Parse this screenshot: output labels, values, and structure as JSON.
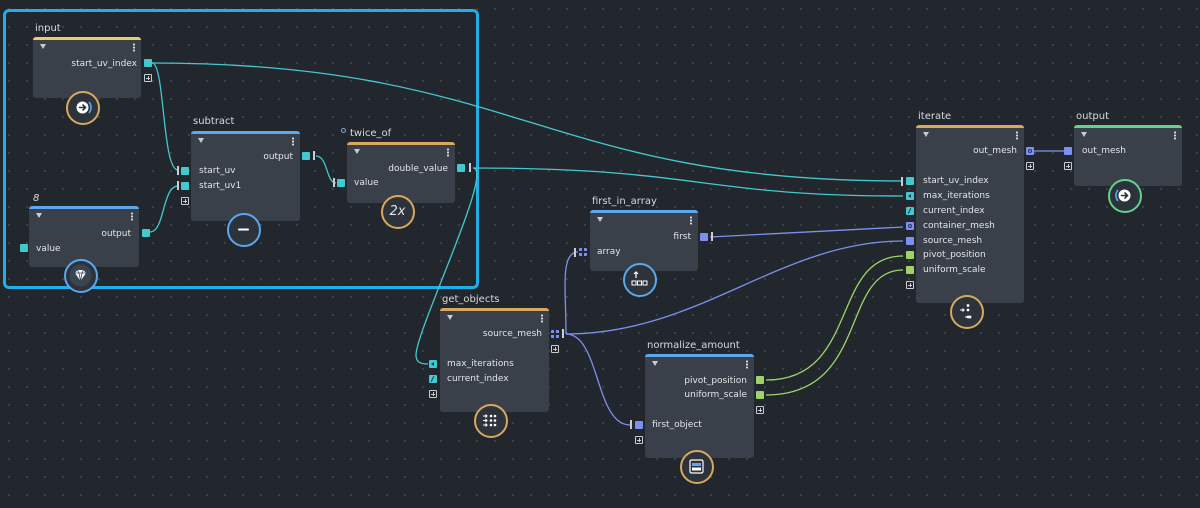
{
  "colors": {
    "background": "#22272d",
    "selection": "#1faee6",
    "node_body": "#3a4049",
    "port_cyan": "#44c8cf",
    "port_green": "#9ed36a",
    "port_blue": "#7d8ff0",
    "header_yellow": "#e8cf6a",
    "header_blue": "#5aa8f0",
    "header_orange": "#d8a85f",
    "header_green": "#63d28e"
  },
  "nodes": {
    "input": {
      "title": "input",
      "outputs": [
        "start_uv_index"
      ],
      "badge_icon": "arrow-right-icon"
    },
    "value8": {
      "title": "8",
      "inputs": [
        "value"
      ],
      "outputs": [
        "output"
      ],
      "badge_icon": "diamond-icon"
    },
    "subtract": {
      "title": "subtract",
      "inputs": [
        "start_uv",
        "start_uv1"
      ],
      "outputs": [
        "output"
      ],
      "badge_icon": "minus-icon"
    },
    "twice_of": {
      "title": "twice_of",
      "inputs": [
        "value"
      ],
      "outputs": [
        "double_value"
      ],
      "badge_text": "2x"
    },
    "first_in_array": {
      "title": "first_in_array",
      "inputs": [
        "array"
      ],
      "outputs": [
        "first"
      ],
      "badge_icon": "first-in-array-icon"
    },
    "get_objects": {
      "title": "get_objects",
      "inputs": [
        "max_iterations",
        "current_index"
      ],
      "outputs": [
        "source_mesh"
      ],
      "badge_icon": "get-objects-icon"
    },
    "normalize_amount": {
      "title": "normalize_amount",
      "inputs": [
        "first_object"
      ],
      "outputs": [
        "pivot_position",
        "uniform_scale"
      ],
      "badge_icon": "normalize-icon"
    },
    "iterate": {
      "title": "iterate",
      "inputs": [
        "start_uv_index",
        "max_iterations",
        "current_index",
        "container_mesh",
        "source_mesh",
        "pivot_position",
        "uniform_scale"
      ],
      "outputs": [
        "out_mesh"
      ],
      "badge_icon": "iterate-icon"
    },
    "output": {
      "title": "output",
      "inputs": [
        "out_mesh"
      ],
      "badge_icon": "arrow-right-icon"
    }
  }
}
